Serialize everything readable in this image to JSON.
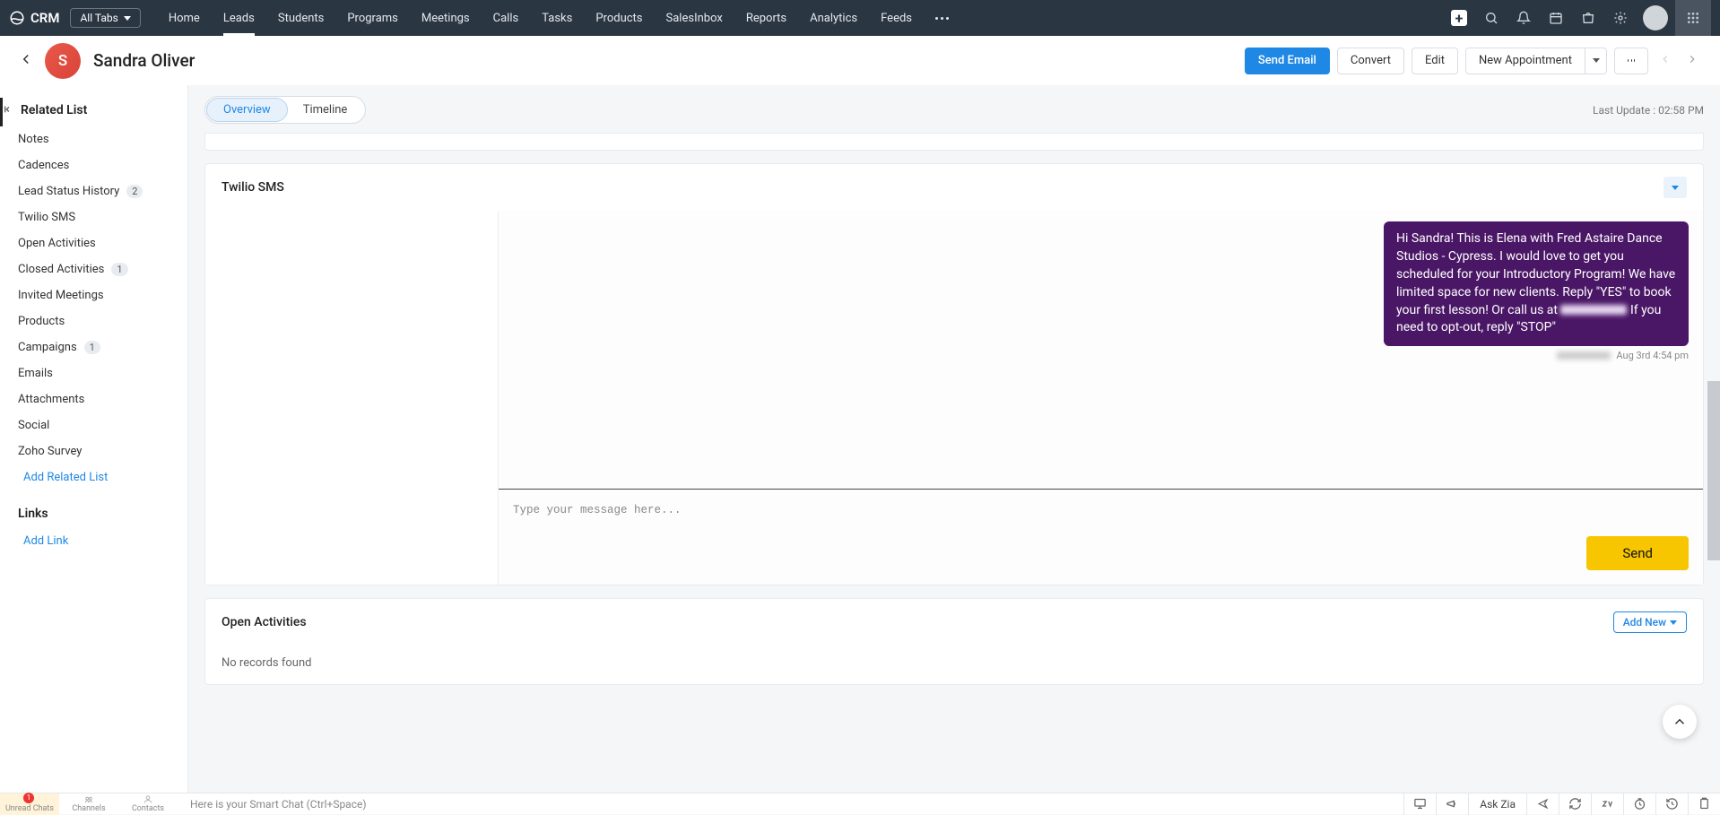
{
  "topbar": {
    "brand": "CRM",
    "alltabs": "All Tabs",
    "nav": [
      "Home",
      "Leads",
      "Students",
      "Programs",
      "Meetings",
      "Calls",
      "Tasks",
      "Products",
      "SalesInbox",
      "Reports",
      "Analytics",
      "Feeds"
    ],
    "active_index": 1
  },
  "header": {
    "avatar_letter": "S",
    "lead_name": "Sandra Oliver",
    "actions": {
      "send_email": "Send Email",
      "convert": "Convert",
      "edit": "Edit",
      "new_appointment": "New Appointment"
    }
  },
  "tabs": {
    "overview": "Overview",
    "timeline": "Timeline",
    "last_update_label": "Last Update :",
    "last_update_time": "02:58 PM"
  },
  "sidebar": {
    "group_title": "Related List",
    "items": [
      {
        "label": "Notes"
      },
      {
        "label": "Cadences"
      },
      {
        "label": "Lead Status History",
        "badge": "2"
      },
      {
        "label": "Twilio SMS"
      },
      {
        "label": "Open Activities"
      },
      {
        "label": "Closed Activities",
        "badge": "1"
      },
      {
        "label": "Invited Meetings"
      },
      {
        "label": "Products"
      },
      {
        "label": "Campaigns",
        "badge": "1"
      },
      {
        "label": "Emails"
      },
      {
        "label": "Attachments"
      },
      {
        "label": "Social"
      },
      {
        "label": "Zoho Survey"
      }
    ],
    "add_related": "Add Related List",
    "links_title": "Links",
    "add_link": "Add Link"
  },
  "twilio": {
    "title": "Twilio SMS",
    "message_part1": "Hi Sandra! This is Elena with Fred Astaire Dance Studios - Cypress. I would love to get you scheduled for your Introductory Program! We have limited space for new clients. Reply \"YES\" to book your first lesson! Or call us at ",
    "message_part2": " If you need to opt-out, reply \"STOP\"",
    "timestamp": "Aug 3rd 4:54 pm",
    "placeholder": "Type your message here...",
    "send": "Send"
  },
  "open_activities": {
    "title": "Open Activities",
    "add_new": "Add New",
    "empty": "No records found"
  },
  "bottombar": {
    "tabs": [
      "Unread Chats",
      "Channels",
      "Contacts"
    ],
    "smartchat": "Here is your Smart Chat (Ctrl+Space)",
    "ask_zia": "Ask Zia",
    "unread_count": "1"
  }
}
